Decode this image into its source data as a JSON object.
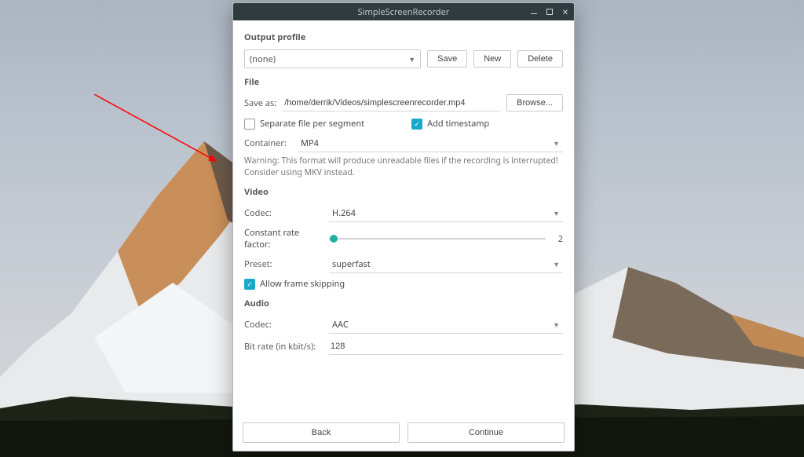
{
  "window": {
    "title": "SimpleScreenRecorder"
  },
  "output_profile": {
    "heading": "Output profile",
    "selected": "(none)",
    "save_btn": "Save",
    "new_btn": "New",
    "delete_btn": "Delete"
  },
  "file": {
    "heading": "File",
    "save_as_label": "Save as:",
    "save_as_value": "/home/derrik/Videos/simplescreenrecorder.mp4",
    "browse_btn": "Browse...",
    "separate_label": "Separate file per segment",
    "separate_checked": false,
    "timestamp_label": "Add timestamp",
    "timestamp_checked": true,
    "container_label": "Container:",
    "container_value": "MP4",
    "warning": "Warning: This format will produce unreadable files if the recording is interrupted! Consider using MKV instead."
  },
  "video": {
    "heading": "Video",
    "codec_label": "Codec:",
    "codec_value": "H.264",
    "crf_label": "Constant rate factor:",
    "crf_value": "2",
    "preset_label": "Preset:",
    "preset_value": "superfast",
    "allow_skip_label": "Allow frame skipping",
    "allow_skip_checked": true
  },
  "audio": {
    "heading": "Audio",
    "codec_label": "Codec:",
    "codec_value": "AAC",
    "bitrate_label": "Bit rate (in kbit/s):",
    "bitrate_value": "128"
  },
  "nav": {
    "back": "Back",
    "continue": "Continue"
  }
}
